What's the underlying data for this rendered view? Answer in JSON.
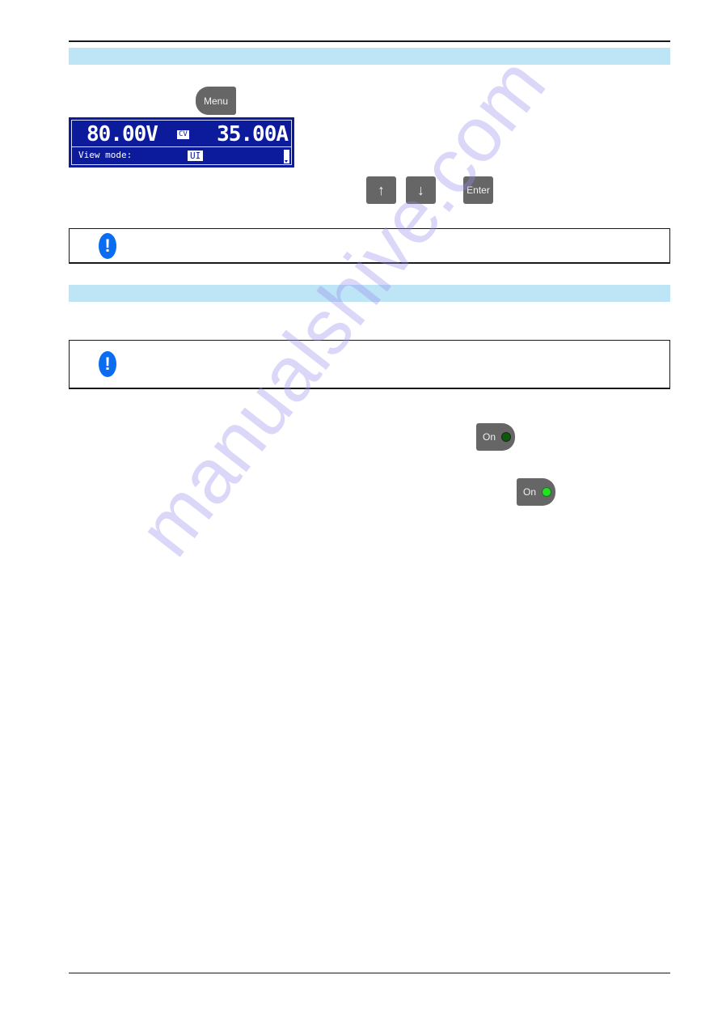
{
  "page": {
    "section_headers": [
      "",
      ""
    ],
    "watermark": "manualshive.com"
  },
  "keys": {
    "menu": "Menu",
    "up_icon": "↑",
    "down_icon": "↓",
    "enter": "Enter",
    "on": "On"
  },
  "lcd": {
    "voltage": "80.00V",
    "regulation_mode": "CV",
    "current": "35.00A",
    "menu_label": "View mode:",
    "menu_value": "UI"
  },
  "notes": [
    {
      "icon": "!",
      "text": ""
    },
    {
      "icon": "!",
      "text": ""
    }
  ],
  "colors": {
    "section_bar": "#bde5f6",
    "lcd_background": "#0c1a9c",
    "key_gray": "#666666",
    "note_icon_blue": "#0a6cf0",
    "led_off": "#0a5a0a",
    "led_on": "#22e022"
  }
}
